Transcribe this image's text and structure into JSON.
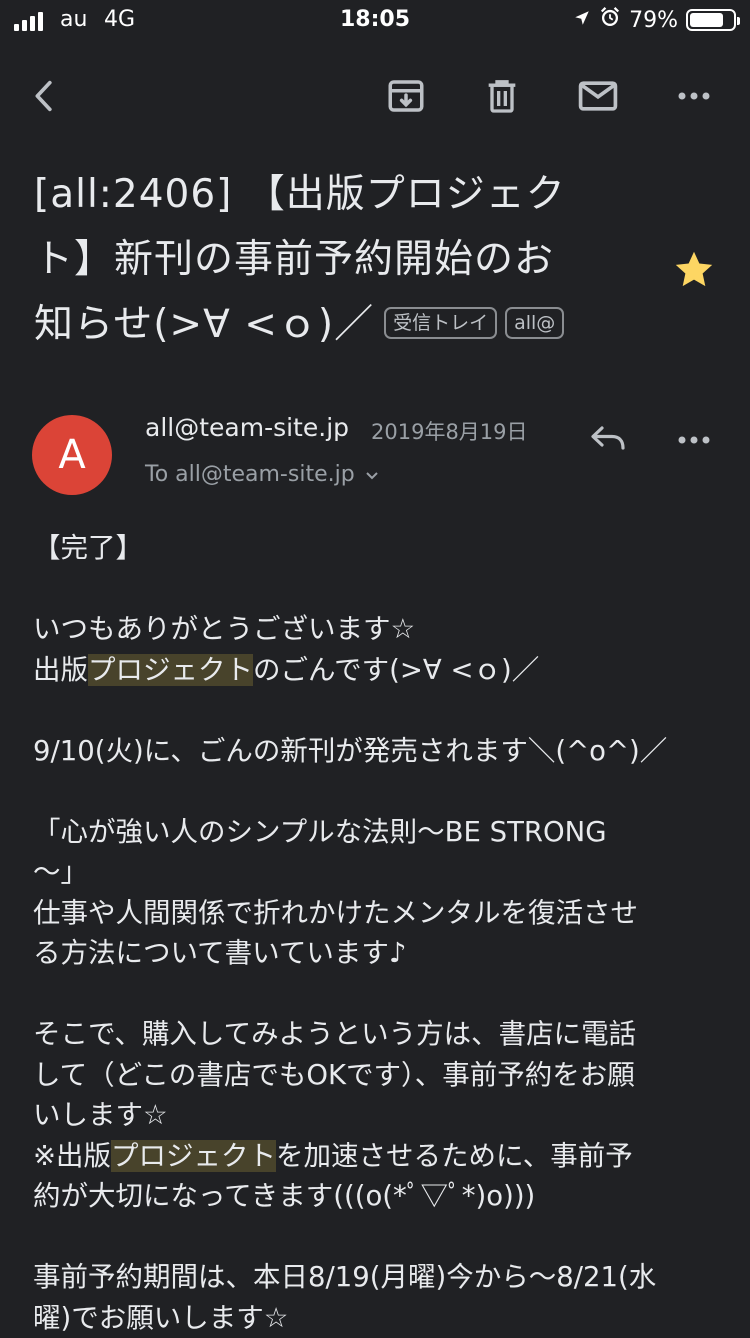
{
  "status_bar": {
    "carrier": "au",
    "network": "4G",
    "time": "18:05",
    "battery_percent_text": "79%",
    "battery_level": 0.79,
    "icons": [
      "signal-icon",
      "location-arrow-icon",
      "alarm-clock-icon",
      "battery-icon"
    ]
  },
  "toolbar": {
    "icons": [
      "back-arrow-icon",
      "archive-icon",
      "trash-icon",
      "mail-unread-icon",
      "more-options-icon"
    ]
  },
  "email": {
    "subject_lines": [
      "[all:2406] 【出版プロジェク",
      "ト】新刊の事前予約開始のお",
      "知らせ(>∀ <ｏ)／"
    ],
    "labels": [
      "受信トレイ",
      "all@"
    ],
    "starred": true,
    "star_color": "#fdd663",
    "sender": {
      "avatar_letter": "A",
      "avatar_color": "#db4437",
      "address": "all@team-site.jp",
      "date": "2019年8月19日",
      "to_line": "To all@team-site.jp"
    },
    "body": {
      "l1": "【完了】",
      "l2": "",
      "l3": "いつもありがとうございます☆",
      "l4a": "出版",
      "l4b": "プロジェクト",
      "l4c": "のごんです(>∀ <ｏ)／",
      "l5": "",
      "l6": "9/10(火)に、ごんの新刊が発売されます＼(^o^)／",
      "l7": "",
      "l8": "「心が強い人のシンプルな法則〜BE STRONG",
      "l9": "〜」",
      "l10": "仕事や人間関係で折れかけたメンタルを復活させ",
      "l11": "る方法について書いています♪",
      "l12": "",
      "l13": "そこで、購入してみようという方は、書店に電話",
      "l14": "して（どこの書店でもOKです）、事前予約をお願",
      "l15": "いします☆",
      "l16a": "※出版",
      "l16b": "プロジェクト",
      "l16c": "を加速させるために、事前予",
      "l17": "約が大切になってきます(((o(*ﾟ▽ﾟ*)o)))",
      "l18": "",
      "l19": "事前予約期間は、本日8/19(月曜)今から〜8/21(水",
      "l20": "曜)でお願いします☆"
    },
    "highlight_color": "#48432b"
  }
}
